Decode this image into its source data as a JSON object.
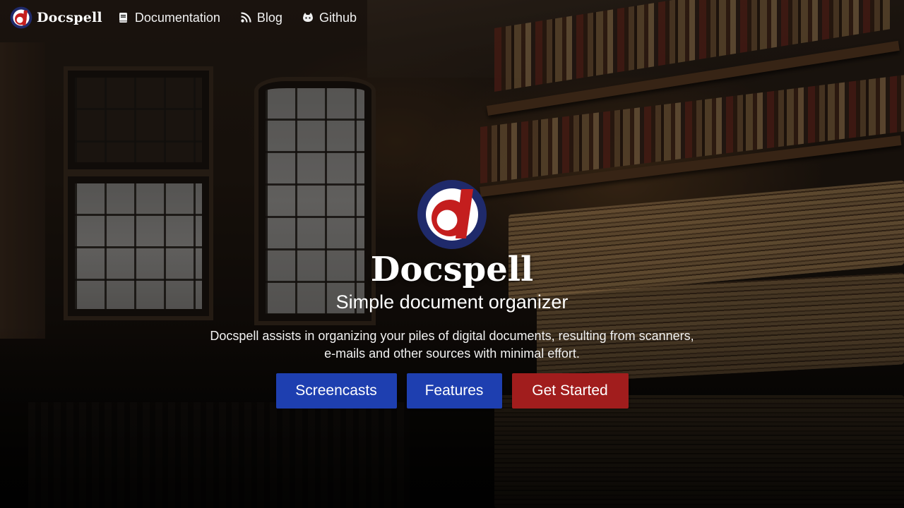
{
  "navbar": {
    "brand": {
      "name": "Docspell",
      "icon": "docspell-logo"
    },
    "links": [
      {
        "label": "Documentation",
        "icon": "book-icon"
      },
      {
        "label": "Blog",
        "icon": "rss-icon"
      },
      {
        "label": "Github",
        "icon": "github-icon"
      }
    ]
  },
  "hero": {
    "logo_icon": "docspell-logo",
    "title": "Docspell",
    "subtitle": "Simple document organizer",
    "description": "Docspell assists in organizing your piles of digital documents, resulting from scanners, e-mails and other sources with minimal effort.",
    "buttons": [
      {
        "label": "Screencasts",
        "color": "#1e3fb0"
      },
      {
        "label": "Features",
        "color": "#1e3fb0"
      },
      {
        "label": "Get Started",
        "color": "#a11d1d"
      }
    ]
  },
  "colors": {
    "logo_ring": "#1f2a6b",
    "logo_red": "#c41e1e",
    "primary_blue": "#1e3fb0",
    "accent_red": "#a11d1d"
  }
}
